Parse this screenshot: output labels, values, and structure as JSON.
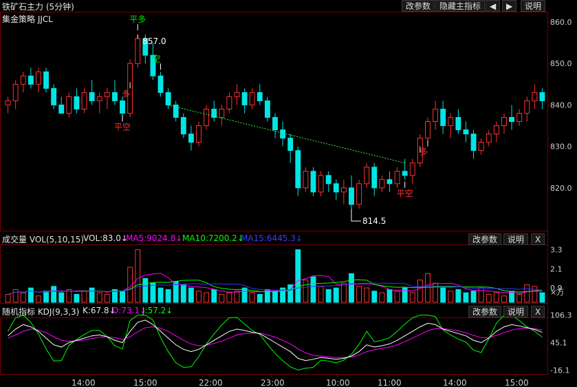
{
  "header": {
    "title": "铁矿石主力 (5分钟)",
    "strategy": "集金策略 JJCL",
    "buttons": [
      "改参数",
      "隐藏主指标",
      "◀",
      "▶",
      "说明"
    ]
  },
  "main": {
    "y_ticks": [
      "860.0",
      "850.0",
      "840.0",
      "830.0",
      "820.0"
    ],
    "annotations": {
      "high_label": "857.0",
      "low_label": "814.5",
      "signals": [
        "平多",
        "多",
        "空",
        "平空",
        "多",
        "平空"
      ]
    }
  },
  "volume": {
    "label": "成交量 VOL(5,10,15)",
    "vol": "VOL:83.0↓",
    "ma5": "MA5:9024.8↓",
    "ma10": "MA10:7200.2↓",
    "ma15": "MA15:6445.3↓",
    "y_ticks": [
      "3.3",
      "2.1",
      "0.9"
    ],
    "unit": "×万",
    "buttons": [
      "改参数",
      "说明",
      "X"
    ]
  },
  "kdj": {
    "label": "随机指标 KDJ(9,3,3)",
    "k": "K:67.8↓",
    "d": "D:73.1↓",
    "j": "J:57.2↓",
    "y_ticks": [
      "106.3",
      "45.1",
      "-16.1"
    ],
    "buttons": [
      "改参数",
      "说明",
      "X"
    ]
  },
  "x_axis": [
    "14:00",
    "15:00",
    "22:00",
    "23:00",
    "10:00",
    "11:00",
    "14:00",
    "15:00"
  ],
  "colors": {
    "up": "#ff3232",
    "down": "#00e5e5",
    "ma5": "#ff00ff",
    "ma10": "#00ff00",
    "ma15": "#3232ff",
    "k": "#ffffff",
    "d": "#ff00ff",
    "j": "#00ff00"
  },
  "chart_data": {
    "type": "candlestick",
    "ylim": [
      810,
      862
    ],
    "ohlc": [
      [
        840,
        842,
        838,
        841
      ],
      [
        841,
        846,
        839,
        845
      ],
      [
        845,
        848,
        843,
        847
      ],
      [
        847,
        849,
        844,
        845
      ],
      [
        845,
        849,
        843,
        848
      ],
      [
        848,
        849,
        843,
        844
      ],
      [
        844,
        845,
        839,
        840
      ],
      [
        840,
        842,
        838,
        838
      ],
      [
        838,
        843,
        837,
        842
      ],
      [
        842,
        844,
        838,
        839
      ],
      [
        839,
        844,
        838,
        843
      ],
      [
        843,
        846,
        840,
        841
      ],
      [
        841,
        843,
        838,
        842
      ],
      [
        842,
        844,
        839,
        843
      ],
      [
        843,
        846,
        840,
        841
      ],
      [
        841,
        842,
        836,
        838
      ],
      [
        838,
        851,
        837,
        850
      ],
      [
        850,
        857,
        849,
        856
      ],
      [
        856,
        857,
        850,
        852
      ],
      [
        852,
        855,
        846,
        847
      ],
      [
        847,
        848,
        842,
        843
      ],
      [
        843,
        844,
        839,
        840
      ],
      [
        840,
        841,
        836,
        837
      ],
      [
        837,
        838,
        832,
        833
      ],
      [
        833,
        835,
        829,
        831
      ],
      [
        831,
        836,
        830,
        835
      ],
      [
        835,
        840,
        834,
        839
      ],
      [
        839,
        841,
        836,
        837
      ],
      [
        837,
        840,
        835,
        839
      ],
      [
        839,
        843,
        838,
        842
      ],
      [
        842,
        845,
        840,
        843
      ],
      [
        843,
        844,
        838,
        840
      ],
      [
        840,
        844,
        839,
        843
      ],
      [
        843,
        845,
        840,
        841
      ],
      [
        841,
        842,
        836,
        837
      ],
      [
        837,
        838,
        832,
        834
      ],
      [
        834,
        836,
        830,
        832
      ],
      [
        832,
        833,
        826,
        829
      ],
      [
        829,
        830,
        818,
        820
      ],
      [
        820,
        825,
        819,
        824
      ],
      [
        824,
        825,
        818,
        819
      ],
      [
        819,
        824,
        818,
        823
      ],
      [
        823,
        824,
        819,
        821
      ],
      [
        821,
        822,
        817,
        819
      ],
      [
        819,
        822,
        816,
        820
      ],
      [
        820,
        823,
        815,
        816
      ],
      [
        816,
        822,
        815,
        821
      ],
      [
        821,
        826,
        820,
        825
      ],
      [
        825,
        826,
        818,
        820
      ],
      [
        820,
        823,
        819,
        822
      ],
      [
        822,
        824,
        819,
        821
      ],
      [
        821,
        825,
        820,
        824
      ],
      [
        824,
        827,
        822,
        823
      ],
      [
        823,
        827,
        821,
        826
      ],
      [
        826,
        833,
        825,
        832
      ],
      [
        832,
        837,
        831,
        836
      ],
      [
        836,
        841,
        834,
        839
      ],
      [
        839,
        841,
        833,
        835
      ],
      [
        835,
        838,
        832,
        837
      ],
      [
        837,
        839,
        833,
        834
      ],
      [
        834,
        836,
        831,
        833
      ],
      [
        833,
        834,
        827,
        829
      ],
      [
        829,
        832,
        828,
        831
      ],
      [
        831,
        834,
        830,
        833
      ],
      [
        833,
        836,
        831,
        835
      ],
      [
        835,
        838,
        833,
        837
      ],
      [
        837,
        840,
        834,
        836
      ],
      [
        836,
        839,
        835,
        838
      ],
      [
        838,
        842,
        836,
        841
      ],
      [
        841,
        845,
        839,
        843
      ],
      [
        843,
        844,
        839,
        841
      ]
    ],
    "volume": [
      0.5,
      0.8,
      0.6,
      0.9,
      0.4,
      0.7,
      1.0,
      0.6,
      0.8,
      0.5,
      0.7,
      0.9,
      0.6,
      0.5,
      0.8,
      0.7,
      2.2,
      3.3,
      1.5,
      1.2,
      0.9,
      0.8,
      1.3,
      1.1,
      0.9,
      0.7,
      0.6,
      0.8,
      0.5,
      0.6,
      0.7,
      0.9,
      0.6,
      0.5,
      0.8,
      0.7,
      0.9,
      1.1,
      3.3,
      1.4,
      1.6,
      1.0,
      0.8,
      0.9,
      1.2,
      1.8,
      1.0,
      0.9,
      0.7,
      0.6,
      0.8,
      0.7,
      0.9,
      0.6,
      1.4,
      1.8,
      1.2,
      0.9,
      0.7,
      0.8,
      0.6,
      0.7,
      0.9,
      0.5,
      0.6,
      0.4,
      0.7,
      0.5,
      1.1,
      1.0,
      0.6
    ],
    "kdj": {
      "k": [
        60,
        75,
        85,
        80,
        70,
        55,
        40,
        35,
        45,
        50,
        55,
        60,
        62,
        58,
        50,
        45,
        70,
        90,
        95,
        85,
        70,
        55,
        40,
        30,
        25,
        30,
        40,
        50,
        60,
        70,
        75,
        72,
        68,
        65,
        55,
        45,
        35,
        25,
        10,
        5,
        8,
        12,
        10,
        8,
        10,
        15,
        25,
        40,
        35,
        38,
        42,
        50,
        60,
        70,
        80,
        88,
        85,
        75,
        70,
        65,
        60,
        50,
        45,
        55,
        70,
        80,
        85,
        82,
        78,
        74,
        67.8
      ],
      "d": [
        55,
        62,
        70,
        75,
        73,
        67,
        58,
        50,
        48,
        49,
        51,
        54,
        57,
        58,
        56,
        52,
        58,
        69,
        78,
        80,
        77,
        70,
        60,
        50,
        42,
        38,
        39,
        43,
        48,
        55,
        62,
        65,
        66,
        66,
        62,
        57,
        50,
        42,
        31,
        22,
        17,
        15,
        13,
        12,
        12,
        13,
        17,
        25,
        29,
        32,
        35,
        40,
        47,
        55,
        63,
        71,
        76,
        76,
        74,
        71,
        67,
        61,
        56,
        56,
        61,
        67,
        73,
        76,
        77,
        76,
        73.1
      ],
      "j": [
        70,
        100,
        106,
        90,
        64,
        31,
        4,
        5,
        39,
        52,
        63,
        72,
        72,
        58,
        38,
        31,
        94,
        106,
        106,
        95,
        56,
        25,
        0,
        -10,
        -9,
        14,
        42,
        64,
        84,
        100,
        101,
        86,
        72,
        63,
        41,
        21,
        5,
        -9,
        -16,
        -12,
        -10,
        6,
        4,
        0,
        6,
        19,
        41,
        70,
        47,
        50,
        56,
        70,
        86,
        100,
        106,
        106,
        103,
        73,
        62,
        53,
        46,
        28,
        23,
        53,
        88,
        106,
        106,
        94,
        80,
        70,
        57.2
      ]
    },
    "x_labels": [
      "14:00",
      "15:00",
      "22:00",
      "23:00",
      "10:00",
      "11:00",
      "14:00",
      "15:00"
    ]
  }
}
